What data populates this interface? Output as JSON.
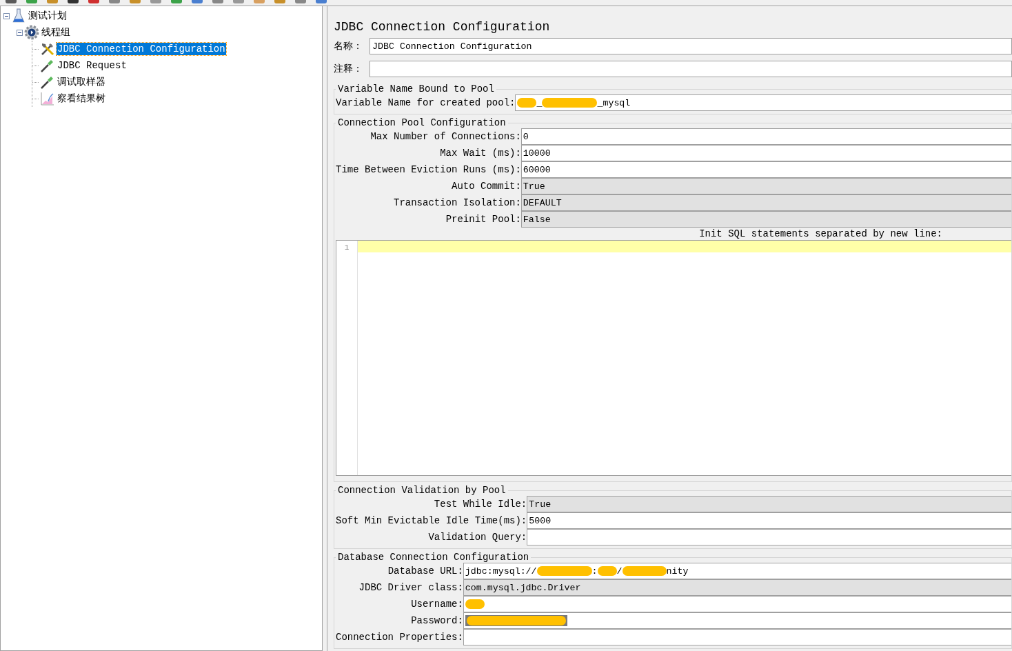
{
  "tree": {
    "items": [
      {
        "label": "测试计划",
        "kind": "plan",
        "expanded": true,
        "selected": false,
        "children": [
          {
            "label": "线程组",
            "kind": "thread-group",
            "expanded": true,
            "selected": false,
            "children": [
              {
                "label": "JDBC Connection Configuration",
                "kind": "config",
                "selected": true
              },
              {
                "label": "JDBC Request",
                "kind": "sampler",
                "selected": false
              },
              {
                "label": "调试取样器",
                "kind": "sampler",
                "selected": false
              },
              {
                "label": "察看结果树",
                "kind": "listener",
                "selected": false
              }
            ]
          }
        ]
      }
    ]
  },
  "panel": {
    "title": "JDBC Connection Configuration",
    "name_field": {
      "label": "名称：",
      "value": "JDBC Connection Configuration"
    },
    "comment_field": {
      "label": "注释："
    },
    "sections": [
      {
        "title": "Variable Name Bound to Pool",
        "fields": [
          {
            "label": "Variable Name for created pool:",
            "kind": "text",
            "segments": [
              {
                "kind": "redacted-short"
              },
              {
                "kind": "text",
                "text": "_"
              },
              {
                "kind": "redacted-long"
              },
              {
                "kind": "text",
                "text": "_mysql"
              }
            ]
          }
        ]
      },
      {
        "title": "Connection Pool Configuration",
        "fields": [
          {
            "label": "Max Number of Connections:",
            "kind": "text",
            "value": "0"
          },
          {
            "label": "Max Wait (ms):",
            "kind": "text",
            "value": "10000"
          },
          {
            "label": "Time Between Eviction Runs (ms):",
            "kind": "text",
            "value": "60000"
          },
          {
            "label": "Auto Commit:",
            "kind": "combo",
            "value": "True"
          },
          {
            "label": "Transaction Isolation:",
            "kind": "combo",
            "value": "DEFAULT"
          },
          {
            "label": "Preinit Pool:",
            "kind": "combo",
            "value": "False"
          }
        ],
        "editor": {
          "label": "Init SQL statements separated by new line:",
          "line_numbers": [
            "1"
          ]
        }
      },
      {
        "title": "Connection Validation by Pool",
        "fields": [
          {
            "label": "Test While Idle:",
            "kind": "combo",
            "value": "True"
          },
          {
            "label": "Soft Min Evictable Idle Time(ms):",
            "kind": "text",
            "value": "5000"
          },
          {
            "label": "Validation Query:",
            "kind": "text"
          }
        ]
      },
      {
        "title": "Database Connection Configuration",
        "fields": [
          {
            "label": "Database URL:",
            "kind": "text",
            "segments": [
              {
                "kind": "text",
                "text": "jdbc:mysql://"
              },
              {
                "kind": "redacted-long"
              },
              {
                "kind": "text",
                "text": ":"
              },
              {
                "kind": "redacted-short"
              },
              {
                "kind": "text",
                "text": "/"
              },
              {
                "kind": "redacted-medium"
              },
              {
                "kind": "text",
                "text": "nity"
              }
            ]
          },
          {
            "label": "JDBC Driver class:",
            "kind": "combo",
            "value": "com.mysql.jdbc.Driver"
          },
          {
            "label": "Username:",
            "kind": "text",
            "segments": [
              {
                "kind": "redacted-short"
              }
            ]
          },
          {
            "label": "Password:",
            "kind": "password",
            "segments": [
              {
                "kind": "redacted-xlong"
              }
            ]
          },
          {
            "label": "Connection Properties:",
            "kind": "text"
          }
        ]
      }
    ]
  }
}
